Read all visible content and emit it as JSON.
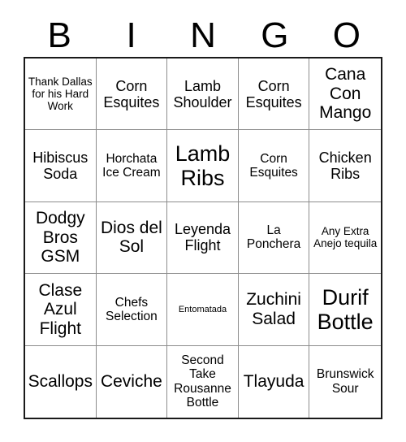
{
  "card": {
    "title": "BINGO",
    "header_letters": [
      "B",
      "I",
      "N",
      "G",
      "O"
    ],
    "columns": 5,
    "rows": 5,
    "colors": {
      "background": "#ffffff",
      "text": "#000000",
      "outer_border": "#1a1a1a",
      "inner_border": "#8c8c8c"
    },
    "cells": [
      {
        "text": "Thank Dallas for his Hard Work",
        "size": "sz-sm"
      },
      {
        "text": "Corn Esquites",
        "size": "sz-lg"
      },
      {
        "text": "Lamb Shoulder",
        "size": "sz-lg"
      },
      {
        "text": "Corn Esquites",
        "size": "sz-lg"
      },
      {
        "text": "Cana Con Mango",
        "size": "sz-xl"
      },
      {
        "text": "Hibiscus Soda",
        "size": "sz-lg"
      },
      {
        "text": "Horchata Ice Cream",
        "size": "sz-md"
      },
      {
        "text": "Lamb Ribs",
        "size": "sz-xxl"
      },
      {
        "text": "Corn Esquites",
        "size": "sz-md"
      },
      {
        "text": "Chicken Ribs",
        "size": "sz-lg"
      },
      {
        "text": "Dodgy Bros GSM",
        "size": "sz-xl"
      },
      {
        "text": "Dios del Sol",
        "size": "sz-xl"
      },
      {
        "text": "Leyenda Flight",
        "size": "sz-lg"
      },
      {
        "text": "La Ponchera",
        "size": "sz-md"
      },
      {
        "text": "Any Extra Anejo tequila",
        "size": "sz-sm"
      },
      {
        "text": "Clase Azul Flight",
        "size": "sz-xl"
      },
      {
        "text": "Chefs Selection",
        "size": "sz-md"
      },
      {
        "text": "Entomatada",
        "size": "sz-xs"
      },
      {
        "text": "Zuchini Salad",
        "size": "sz-xl"
      },
      {
        "text": "Durif Bottle",
        "size": "sz-xxl"
      },
      {
        "text": "Scallops",
        "size": "sz-xl"
      },
      {
        "text": "Ceviche",
        "size": "sz-xl"
      },
      {
        "text": "Second Take Rousanne Bottle",
        "size": "sz-md"
      },
      {
        "text": "Tlayuda",
        "size": "sz-xl"
      },
      {
        "text": "Brunswick Sour",
        "size": "sz-md"
      }
    ]
  }
}
